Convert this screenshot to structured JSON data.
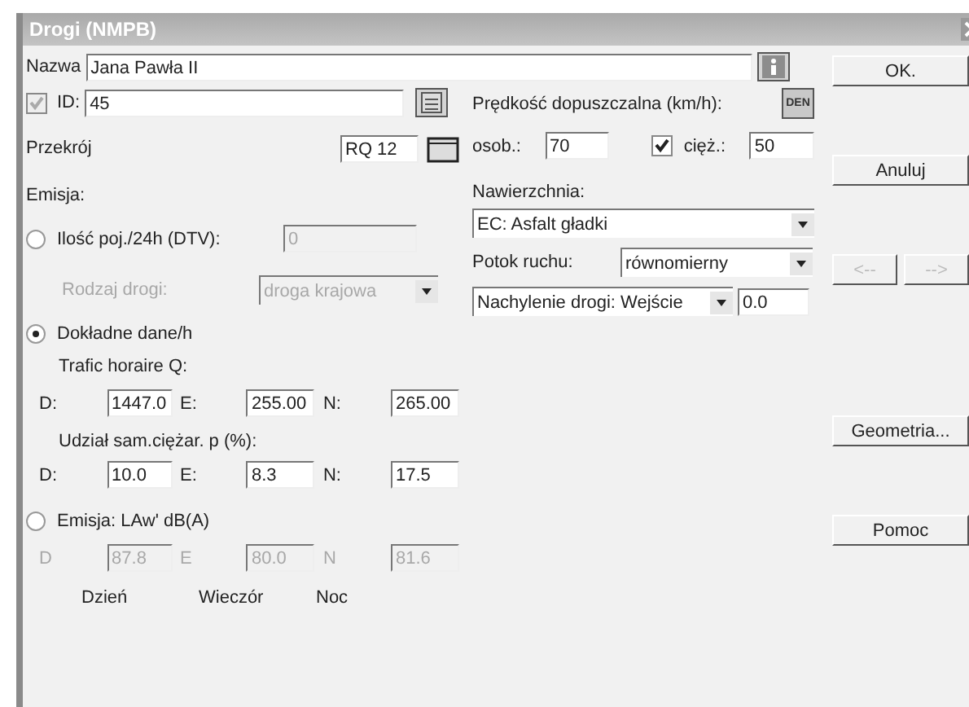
{
  "window": {
    "title": "Drogi (NMPB)"
  },
  "name": {
    "label": "Nazwa",
    "value": "Jana Pawła II"
  },
  "id": {
    "label": "ID:",
    "value": "45",
    "checked": true,
    "disabled": true
  },
  "cross_section": {
    "label": "Przekrój",
    "value": "RQ 12"
  },
  "speed": {
    "label": "Prędkość dopuszczalna (km/h):",
    "button": "DEN",
    "car_label": "osob.:",
    "car_value": "70",
    "truck_checked": true,
    "truck_label": "cięż.:",
    "truck_value": "50"
  },
  "emission": {
    "label": "Emisja:",
    "dtv": {
      "label": "Ilość poj./24h (DTV):",
      "selected": false,
      "value": "0",
      "disabled": true,
      "road_type_label": "Rodzaj drogi:",
      "road_type": "droga krajowa"
    },
    "exact": {
      "label": "Dokładne dane/h",
      "selected": true,
      "traffic_label": "Trafic horaire Q:",
      "traffic": [
        {
          "label": "D:",
          "value": "1447.0",
          "disabled": false
        },
        {
          "label": "E:",
          "value": "255.00",
          "disabled": false
        },
        {
          "label": "N:",
          "value": "265.00",
          "disabled": false
        }
      ],
      "share_label": "Udział sam.ciężar. p (%):",
      "share": [
        {
          "label": "D:",
          "value": "10.0",
          "disabled": false
        },
        {
          "label": "E:",
          "value": "8.3",
          "disabled": false
        },
        {
          "label": "N:",
          "value": "17.5",
          "disabled": false
        }
      ]
    },
    "level": {
      "label": "Emisja: LAw' dB(A)",
      "selected": false,
      "values": [
        {
          "label": "D",
          "value": "87.8",
          "disabled": true
        },
        {
          "label": "E",
          "value": "80.0",
          "disabled": true
        },
        {
          "label": "N",
          "value": "81.6",
          "disabled": true
        }
      ],
      "captions": [
        "Dzień",
        "Wieczór",
        "Noc"
      ]
    }
  },
  "surface": {
    "label": "Nawierzchnia:",
    "value": "EC: Asfalt gładki"
  },
  "flow": {
    "label": "Potok ruchu:",
    "value": "równomierny"
  },
  "slope": {
    "value": "Nachylenie drogi: Wejście",
    "number": "0.0"
  },
  "buttons": [
    {
      "label": "OK.",
      "kind": "wide",
      "disabled": false
    },
    {
      "label": "Anuluj",
      "kind": "wide",
      "disabled": false
    },
    {
      "label": "<--",
      "kind": "half",
      "disabled": true
    },
    {
      "label": "-->",
      "kind": "half",
      "disabled": true
    },
    {
      "label": "Geometria...",
      "kind": "wide",
      "disabled": false
    },
    {
      "label": "Pomoc",
      "kind": "wide",
      "disabled": false
    }
  ]
}
